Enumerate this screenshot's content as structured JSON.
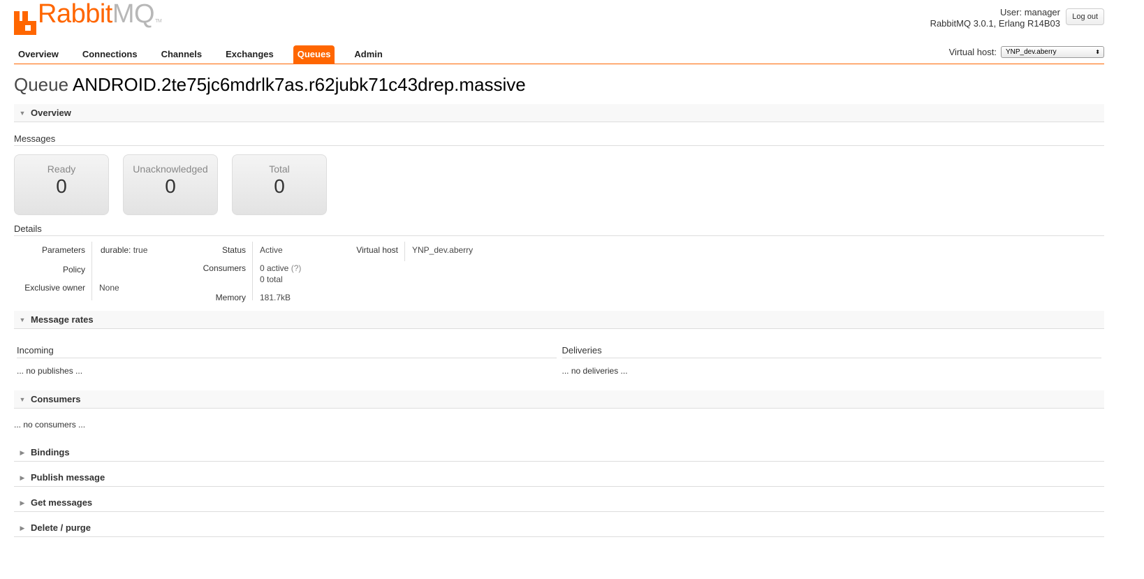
{
  "header": {
    "logo_rabbit": "Rabbit",
    "logo_mq": "MQ",
    "logo_tm": "TM",
    "user_label": "User:",
    "user_name": "manager",
    "version": "RabbitMQ 3.0.1, Erlang R14B03",
    "logout": "Log out"
  },
  "nav": {
    "tabs": [
      {
        "label": "Overview",
        "active": false
      },
      {
        "label": "Connections",
        "active": false
      },
      {
        "label": "Channels",
        "active": false
      },
      {
        "label": "Exchanges",
        "active": false
      },
      {
        "label": "Queues",
        "active": true
      },
      {
        "label": "Admin",
        "active": false
      }
    ],
    "vhost_label": "Virtual host:",
    "vhost_value": "YNP_dev.aberry"
  },
  "page": {
    "title_prefix": "Queue",
    "queue_name": "ANDROID.2te75jc6mdrlk7as.r62jubk71c43drep.massive"
  },
  "overview": {
    "heading": "Overview",
    "messages_heading": "Messages",
    "counters": [
      {
        "label": "Ready",
        "value": "0"
      },
      {
        "label": "Unacknowledged",
        "value": "0"
      },
      {
        "label": "Total",
        "value": "0"
      }
    ],
    "details_heading": "Details",
    "details": {
      "parameters_label": "Parameters",
      "parameters_key": "durable:",
      "parameters_value": "true",
      "policy_label": "Policy",
      "policy_value": "",
      "exclusive_label": "Exclusive owner",
      "exclusive_value": "None",
      "status_label": "Status",
      "status_value": "Active",
      "consumers_label": "Consumers",
      "consumers_active": "0 active",
      "consumers_help": "(?)",
      "consumers_total": "0 total",
      "memory_label": "Memory",
      "memory_value": "181.7kB",
      "vhost_label": "Virtual host",
      "vhost_value": "YNP_dev.aberry"
    }
  },
  "message_rates": {
    "heading": "Message rates",
    "incoming_heading": "Incoming",
    "incoming_note": "... no publishes ...",
    "deliveries_heading": "Deliveries",
    "deliveries_note": "... no deliveries ..."
  },
  "consumers": {
    "heading": "Consumers",
    "note": "... no consumers ..."
  },
  "collapsed_sections": [
    {
      "heading": "Bindings"
    },
    {
      "heading": "Publish message"
    },
    {
      "heading": "Get messages"
    },
    {
      "heading": "Delete / purge"
    }
  ],
  "icons": {
    "logo": "rabbit-logo-icon",
    "expanded": "triangle-down-icon",
    "collapsed": "triangle-right-icon",
    "dropdown": "updown-arrows-icon"
  },
  "colors": {
    "accent": "#ff6600",
    "logo_grey": "#b7b7b7",
    "section_bg": "#f8f8f8"
  }
}
